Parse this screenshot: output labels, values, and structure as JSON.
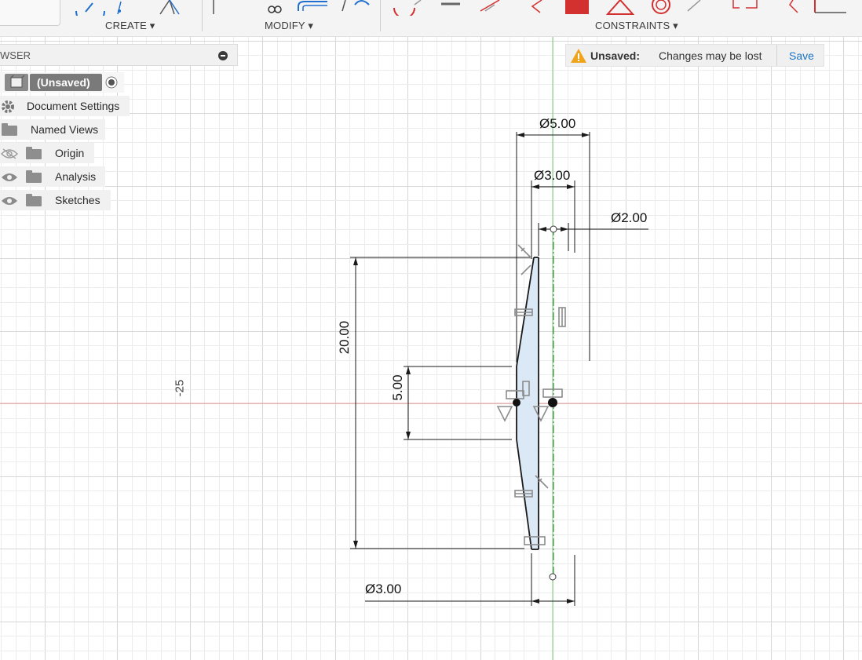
{
  "toolbar": {
    "create_label": "CREATE ▾",
    "modify_label": "MODIFY ▾",
    "constraints_label": "CONSTRAINTS ▾"
  },
  "browser": {
    "title": "WSER",
    "items": [
      {
        "label": "(Unsaved)",
        "icon": "component-icon"
      },
      {
        "label": "Document Settings",
        "icon": "gear-icon"
      },
      {
        "label": "Named Views",
        "icon": "folder-icon"
      },
      {
        "label": "Origin",
        "icon": "folder-icon",
        "visibility": "hidden"
      },
      {
        "label": "Analysis",
        "icon": "folder-icon",
        "visibility": "visible"
      },
      {
        "label": "Sketches",
        "icon": "folder-icon",
        "visibility": "visible"
      }
    ]
  },
  "notice": {
    "label": "Unsaved:",
    "message": "Changes may be lost",
    "save_label": "Save"
  },
  "sketch": {
    "dims": {
      "dia_top": "Ø5.00",
      "dia_mid": "Ø3.00",
      "dia_small": "Ø2.00",
      "height": "20.00",
      "inner_height": "5.00",
      "dia_bottom": "Ø3.00"
    },
    "axis_label": "-25"
  },
  "colors": {
    "grid_minor": "#ececec",
    "grid_major": "#d6d6d6",
    "axis_x": "#e89a9a",
    "axis_y": "#7fd07f",
    "profile_fill": "#dbe9f6",
    "accent_red": "#d33030",
    "accent_blue": "#1f6fd0"
  }
}
